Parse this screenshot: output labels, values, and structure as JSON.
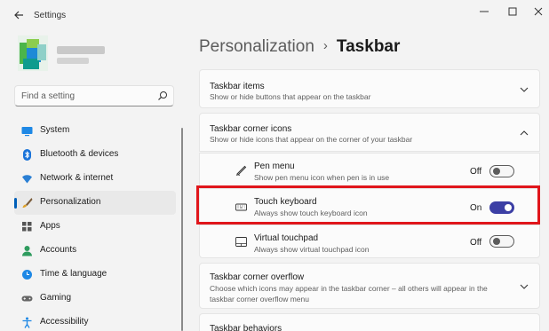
{
  "window": {
    "back_icon": "back-arrow-icon",
    "title": "Settings",
    "controls": [
      "minimize-icon",
      "maximize-icon",
      "close-icon"
    ]
  },
  "search": {
    "placeholder": "Find a setting",
    "icon": "search-icon"
  },
  "nav": {
    "items": [
      {
        "label": "System",
        "icon": "monitor-icon"
      },
      {
        "label": "Bluetooth & devices",
        "icon": "bluetooth-icon"
      },
      {
        "label": "Network & internet",
        "icon": "wifi-icon"
      },
      {
        "label": "Personalization",
        "icon": "brush-icon",
        "active": true
      },
      {
        "label": "Apps",
        "icon": "apps-icon"
      },
      {
        "label": "Accounts",
        "icon": "person-icon"
      },
      {
        "label": "Time & language",
        "icon": "globe-clock-icon"
      },
      {
        "label": "Gaming",
        "icon": "gamepad-icon"
      },
      {
        "label": "Accessibility",
        "icon": "accessibility-icon"
      }
    ]
  },
  "breadcrumb": {
    "parent": "Personalization",
    "separator": "›",
    "current": "Taskbar"
  },
  "sections": {
    "taskbar_items": {
      "title": "Taskbar items",
      "desc": "Show or hide buttons that appear on the taskbar",
      "expanded": false
    },
    "corner_icons": {
      "title": "Taskbar corner icons",
      "desc": "Show or hide icons that appear on the corner of your taskbar",
      "expanded": true,
      "items": [
        {
          "title": "Pen menu",
          "desc": "Show pen menu icon when pen is in use",
          "state": "Off",
          "on": false,
          "icon": "pen-icon"
        },
        {
          "title": "Touch keyboard",
          "desc": "Always show touch keyboard icon",
          "state": "On",
          "on": true,
          "icon": "keyboard-icon"
        },
        {
          "title": "Virtual touchpad",
          "desc": "Always show virtual touchpad icon",
          "state": "Off",
          "on": false,
          "icon": "touchpad-icon"
        }
      ]
    },
    "corner_overflow": {
      "title": "Taskbar corner overflow",
      "desc": "Choose which icons may appear in the taskbar corner – all others will appear in the taskbar corner overflow menu",
      "expanded": false
    },
    "behaviors": {
      "title": "Taskbar behaviors"
    }
  },
  "colors": {
    "accent": "#3c3fa5",
    "highlight_box": "#e0161b",
    "nav_indicator": "#005fb8"
  }
}
